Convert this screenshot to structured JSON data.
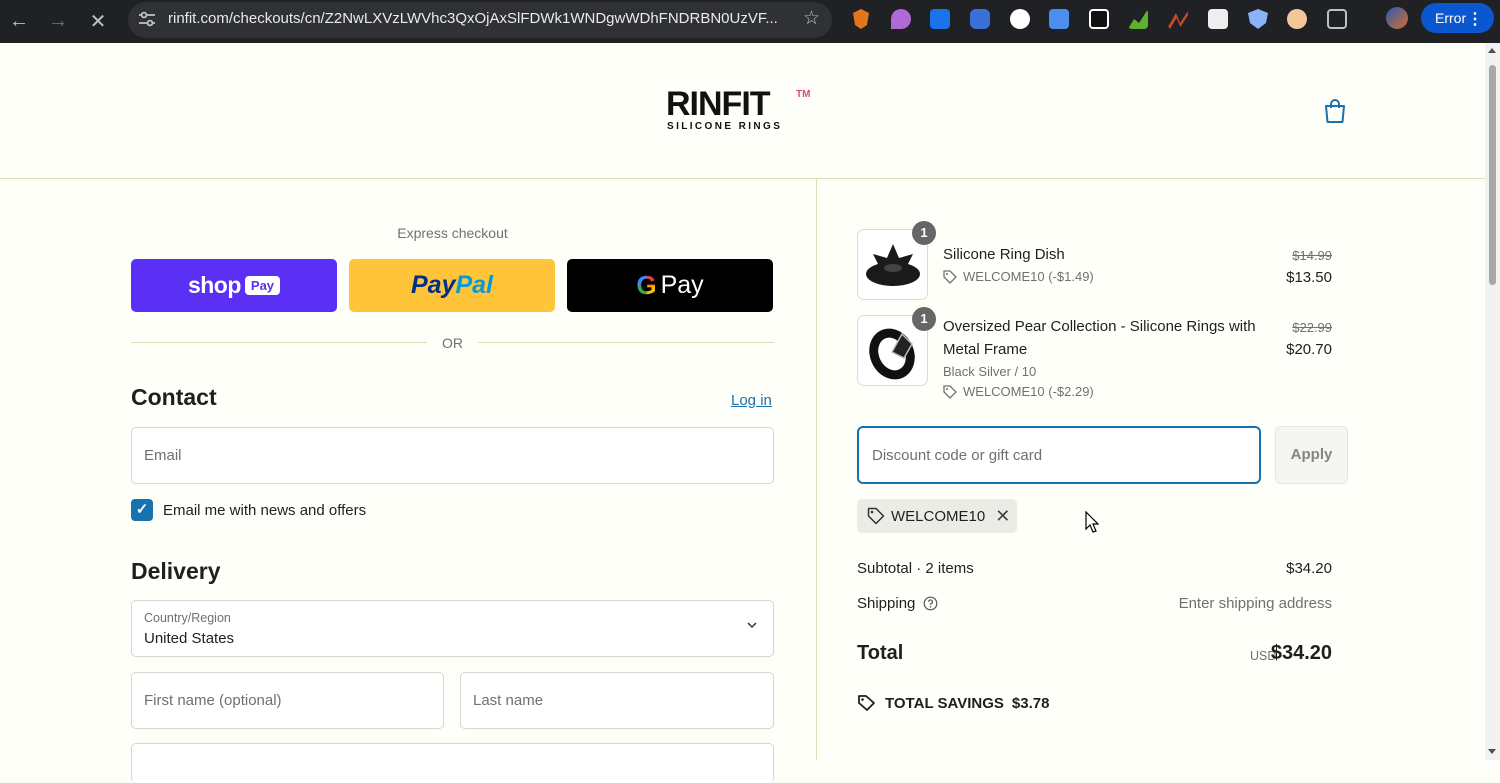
{
  "browser": {
    "url": "rinfit.com/checkouts/cn/Z2NwLXVzLWVhc3QxOjAxSlFDWk1WNDgwWDhFNDRBN0UzVF...",
    "error_label": "Error",
    "colors": {
      "chrome": "#202124",
      "error_button": "#0b57d0"
    }
  },
  "header": {
    "logo_word": "RINFIT",
    "logo_tm": "TM",
    "logo_sub": "SILICONE RINGS"
  },
  "express": {
    "title": "Express checkout",
    "shoppay_word": "shop",
    "shoppay_badge": "Pay",
    "paypal_a": "Pay",
    "paypal_b": "Pal",
    "gpay_g": "G",
    "gpay_word": "Pay",
    "or_label": "OR"
  },
  "contact": {
    "heading": "Contact",
    "login_link": "Log in",
    "email_placeholder": "Email",
    "newsletter_label": "Email me with news and offers",
    "newsletter_checked": true
  },
  "delivery": {
    "heading": "Delivery",
    "country_label": "Country/Region",
    "country_value": "United States",
    "first_name_placeholder": "First name (optional)",
    "last_name_placeholder": "Last name"
  },
  "cart": {
    "items": [
      {
        "qty": "1",
        "name": "Silicone Ring Dish",
        "variant": "",
        "discount": "WELCOME10 (-$1.49)",
        "price_old": "$14.99",
        "price": "$13.50"
      },
      {
        "qty": "1",
        "name": "Oversized Pear Collection - Silicone Rings with Metal Frame",
        "variant": "Black Silver / 10",
        "discount": "WELCOME10 (-$2.29)",
        "price_old": "$22.99",
        "price": "$20.70"
      }
    ],
    "discount_placeholder": "Discount code or gift card",
    "apply_label": "Apply",
    "applied_code": "WELCOME10",
    "subtotal_label": "Subtotal · 2 items",
    "subtotal_value": "$34.20",
    "shipping_label": "Shipping",
    "shipping_value": "Enter shipping address",
    "total_label": "Total",
    "total_currency": "USD",
    "total_value": "$34.20",
    "savings_label": "TOTAL SAVINGS",
    "savings_value": "$3.78"
  },
  "colors": {
    "accent": "#1773b0",
    "shoppay": "#5a31f4",
    "paypal": "#ffc439",
    "page_bg": "#fffff9"
  }
}
